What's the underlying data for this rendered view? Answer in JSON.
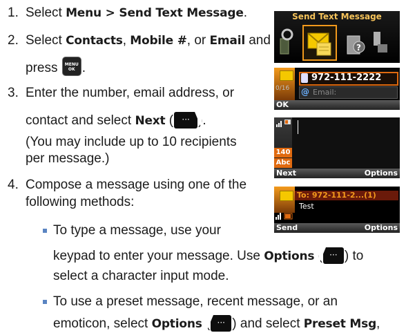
{
  "steps": [
    {
      "num": "1.",
      "pre": "Select ",
      "bold1": "Menu > Send Text Message",
      "post": "."
    },
    {
      "num": "2.",
      "pre": "Select ",
      "bold1": "Contacts",
      "mid1": ", ",
      "bold2": "Mobile #",
      "mid2": ", or ",
      "bold3": "Email",
      "post": " and",
      "line2_pre": "press ",
      "line2_post": "."
    },
    {
      "num": "3.",
      "line1": "Enter the number, email address, or",
      "line2_pre": "contact and select ",
      "line2_bold": "Next",
      "line2_mid": " (",
      "line2_post": ").",
      "line3": "(You may include up to 10 recipients",
      "line4": "per message.)"
    },
    {
      "num": "4.",
      "line1": "Compose a message using one of the",
      "line2": "following methods:"
    }
  ],
  "bullets": [
    {
      "line1": "To type a message, use your",
      "line2_pre": "keypad to enter your message. Use ",
      "line2_bold": "Options",
      "line2_mid": " (",
      "line2_post": ") to",
      "line3": "select a character input mode."
    },
    {
      "line1": "To use a preset message, recent message, or an",
      "line2_pre": "emoticon, select ",
      "line2_bold": "Options",
      "line2_mid": " (",
      "line2_post": ") and select ",
      "line2_bold2": "Preset Msg",
      "line2_end": ","
    }
  ],
  "icons": {
    "menu_ok_key": {
      "top": "MENU",
      "bottom": "OK"
    },
    "left_soft_key": "···",
    "right_soft_key": "···"
  },
  "screens": {
    "s1": {
      "title": "Send Text Message"
    },
    "s2": {
      "counter": "0/16",
      "number": "972-111-2222",
      "email_placeholder": "Email:",
      "soft_left": "OK"
    },
    "s3": {
      "count": "140",
      "mode": "Abc",
      "soft_left": "Next",
      "soft_right": "Options"
    },
    "s4": {
      "to": "To: 972-111-2...(1)",
      "text": "Test",
      "soft_left": "Send",
      "soft_right": "Options"
    }
  },
  "colors": {
    "bullet": "#5a84c2",
    "accent_orange": "#f39a1c",
    "screen_bg": "#000000"
  }
}
